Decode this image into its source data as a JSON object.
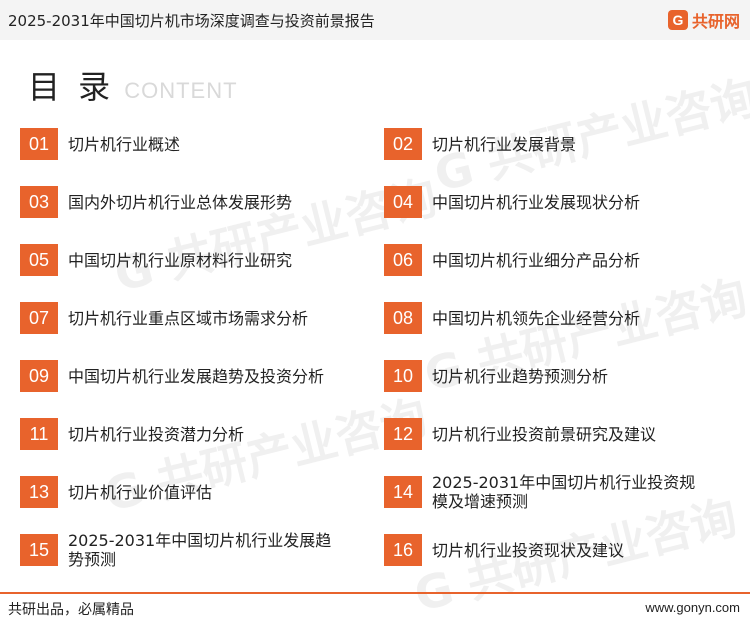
{
  "header": {
    "title": "2025-2031年中国切片机市场深度调查与投资前景报告",
    "logo_mark": "G",
    "logo_text": "共研网"
  },
  "heading": {
    "cn": "目 录",
    "en": "CONTENT"
  },
  "watermark": "G 共研产业咨询",
  "toc": [
    {
      "num": "01",
      "label": "切片机行业概述"
    },
    {
      "num": "02",
      "label": "切片机行业发展背景"
    },
    {
      "num": "03",
      "label": "国内外切片机行业总体发展形势"
    },
    {
      "num": "04",
      "label": "中国切片机行业发展现状分析"
    },
    {
      "num": "05",
      "label": "中国切片机行业原材料行业研究"
    },
    {
      "num": "06",
      "label": "中国切片机行业细分产品分析"
    },
    {
      "num": "07",
      "label": "切片机行业重点区域市场需求分析"
    },
    {
      "num": "08",
      "label": "中国切片机领先企业经营分析"
    },
    {
      "num": "09",
      "label": "中国切片机行业发展趋势及投资分析"
    },
    {
      "num": "10",
      "label": "切片机行业趋势预测分析"
    },
    {
      "num": "11",
      "label": "切片机行业投资潜力分析"
    },
    {
      "num": "12",
      "label": "切片机行业投资前景研究及建议"
    },
    {
      "num": "13",
      "label": "切片机行业价值评估"
    },
    {
      "num": "14",
      "label": "2025-2031年中国切片机行业投资规模及增速预测"
    },
    {
      "num": "15",
      "label": "2025-2031年中国切片机行业发展趋势预测"
    },
    {
      "num": "16",
      "label": "切片机行业投资现状及建议"
    }
  ],
  "footer": {
    "left": "共研出品，必属精品",
    "right": "www.gonyn.com"
  },
  "colors": {
    "accent": "#e8632c"
  }
}
